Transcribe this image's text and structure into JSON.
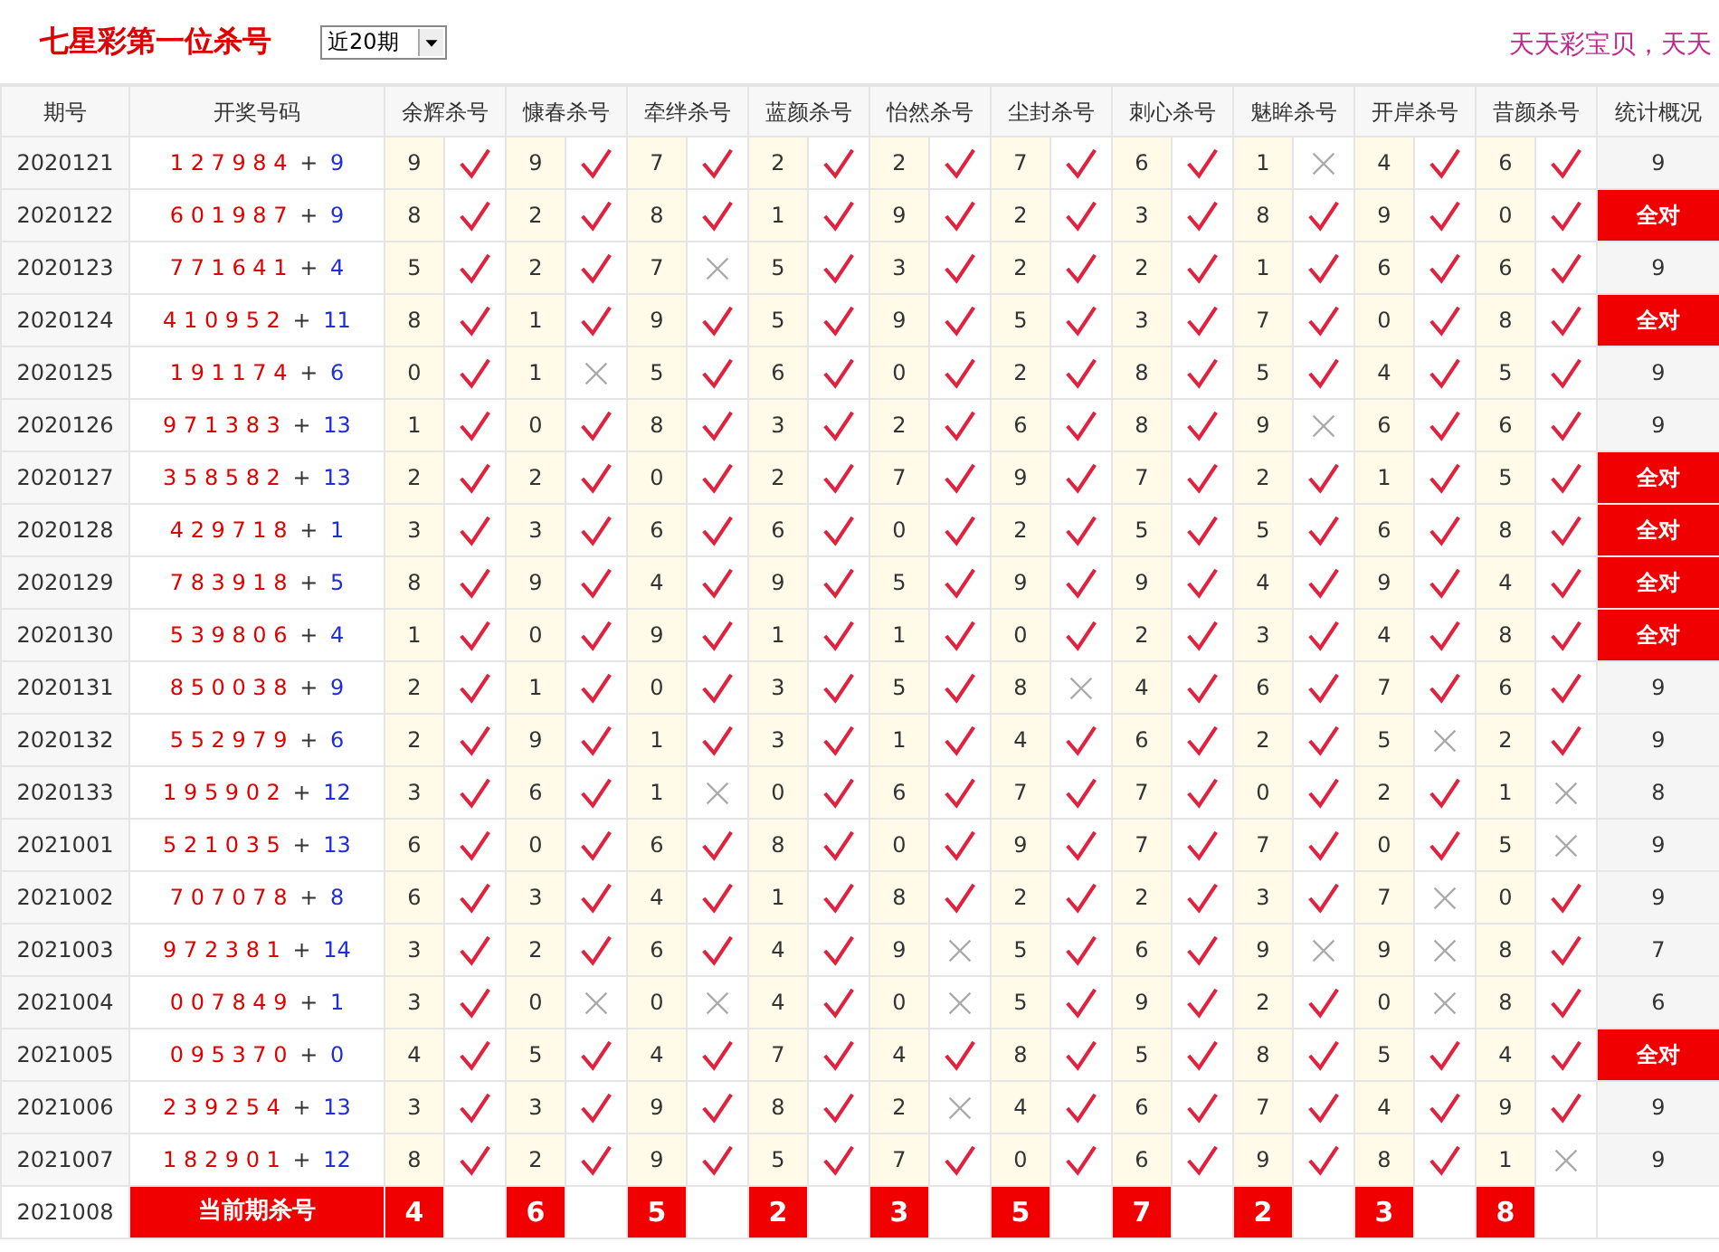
{
  "title": "七星彩第一位杀号",
  "period_select": {
    "value": "近20期"
  },
  "slogan": "天天彩宝贝，天天",
  "columns": [
    "期号",
    "开奖号码",
    "余辉杀号",
    "慷春杀号",
    "牵绊杀号",
    "蓝颜杀号",
    "怡然杀号",
    "尘封杀号",
    "刺心杀号",
    "魅眸杀号",
    "开岸杀号",
    "昔颜杀号",
    "统计概况"
  ],
  "rows": [
    {
      "period": "2020121",
      "main": "1 2 7 9 8 4",
      "plus": "+",
      "bonus": "9",
      "kills": [
        {
          "n": "9",
          "hit": true
        },
        {
          "n": "9",
          "hit": true
        },
        {
          "n": "7",
          "hit": true
        },
        {
          "n": "2",
          "hit": true
        },
        {
          "n": "2",
          "hit": true
        },
        {
          "n": "7",
          "hit": true
        },
        {
          "n": "6",
          "hit": true
        },
        {
          "n": "1",
          "hit": false
        },
        {
          "n": "4",
          "hit": true
        },
        {
          "n": "6",
          "hit": true
        }
      ],
      "stat": "9",
      "all_correct": false
    },
    {
      "period": "2020122",
      "main": "6 0 1 9 8 7",
      "plus": "+",
      "bonus": "9",
      "kills": [
        {
          "n": "8",
          "hit": true
        },
        {
          "n": "2",
          "hit": true
        },
        {
          "n": "8",
          "hit": true
        },
        {
          "n": "1",
          "hit": true
        },
        {
          "n": "9",
          "hit": true
        },
        {
          "n": "2",
          "hit": true
        },
        {
          "n": "3",
          "hit": true
        },
        {
          "n": "8",
          "hit": true
        },
        {
          "n": "9",
          "hit": true
        },
        {
          "n": "0",
          "hit": true
        }
      ],
      "stat": "全对",
      "all_correct": true
    },
    {
      "period": "2020123",
      "main": "7 7 1 6 4 1",
      "plus": "+",
      "bonus": "4",
      "kills": [
        {
          "n": "5",
          "hit": true
        },
        {
          "n": "2",
          "hit": true
        },
        {
          "n": "7",
          "hit": false
        },
        {
          "n": "5",
          "hit": true
        },
        {
          "n": "3",
          "hit": true
        },
        {
          "n": "2",
          "hit": true
        },
        {
          "n": "2",
          "hit": true
        },
        {
          "n": "1",
          "hit": true
        },
        {
          "n": "6",
          "hit": true
        },
        {
          "n": "6",
          "hit": true
        }
      ],
      "stat": "9",
      "all_correct": false
    },
    {
      "period": "2020124",
      "main": "4 1 0 9 5 2",
      "plus": "+",
      "bonus": "11",
      "kills": [
        {
          "n": "8",
          "hit": true
        },
        {
          "n": "1",
          "hit": true
        },
        {
          "n": "9",
          "hit": true
        },
        {
          "n": "5",
          "hit": true
        },
        {
          "n": "9",
          "hit": true
        },
        {
          "n": "5",
          "hit": true
        },
        {
          "n": "3",
          "hit": true
        },
        {
          "n": "7",
          "hit": true
        },
        {
          "n": "0",
          "hit": true
        },
        {
          "n": "8",
          "hit": true
        }
      ],
      "stat": "全对",
      "all_correct": true
    },
    {
      "period": "2020125",
      "main": "1 9 1 1 7 4",
      "plus": "+",
      "bonus": "6",
      "kills": [
        {
          "n": "0",
          "hit": true
        },
        {
          "n": "1",
          "hit": false
        },
        {
          "n": "5",
          "hit": true
        },
        {
          "n": "6",
          "hit": true
        },
        {
          "n": "0",
          "hit": true
        },
        {
          "n": "2",
          "hit": true
        },
        {
          "n": "8",
          "hit": true
        },
        {
          "n": "5",
          "hit": true
        },
        {
          "n": "4",
          "hit": true
        },
        {
          "n": "5",
          "hit": true
        }
      ],
      "stat": "9",
      "all_correct": false
    },
    {
      "period": "2020126",
      "main": "9 7 1 3 8 3",
      "plus": "+",
      "bonus": "13",
      "kills": [
        {
          "n": "1",
          "hit": true
        },
        {
          "n": "0",
          "hit": true
        },
        {
          "n": "8",
          "hit": true
        },
        {
          "n": "3",
          "hit": true
        },
        {
          "n": "2",
          "hit": true
        },
        {
          "n": "6",
          "hit": true
        },
        {
          "n": "8",
          "hit": true
        },
        {
          "n": "9",
          "hit": false
        },
        {
          "n": "6",
          "hit": true
        },
        {
          "n": "6",
          "hit": true
        }
      ],
      "stat": "9",
      "all_correct": false
    },
    {
      "period": "2020127",
      "main": "3 5 8 5 8 2",
      "plus": "+",
      "bonus": "13",
      "kills": [
        {
          "n": "2",
          "hit": true
        },
        {
          "n": "2",
          "hit": true
        },
        {
          "n": "0",
          "hit": true
        },
        {
          "n": "2",
          "hit": true
        },
        {
          "n": "7",
          "hit": true
        },
        {
          "n": "9",
          "hit": true
        },
        {
          "n": "7",
          "hit": true
        },
        {
          "n": "2",
          "hit": true
        },
        {
          "n": "1",
          "hit": true
        },
        {
          "n": "5",
          "hit": true
        }
      ],
      "stat": "全对",
      "all_correct": true
    },
    {
      "period": "2020128",
      "main": "4 2 9 7 1 8",
      "plus": "+",
      "bonus": "1",
      "kills": [
        {
          "n": "3",
          "hit": true
        },
        {
          "n": "3",
          "hit": true
        },
        {
          "n": "6",
          "hit": true
        },
        {
          "n": "6",
          "hit": true
        },
        {
          "n": "0",
          "hit": true
        },
        {
          "n": "2",
          "hit": true
        },
        {
          "n": "5",
          "hit": true
        },
        {
          "n": "5",
          "hit": true
        },
        {
          "n": "6",
          "hit": true
        },
        {
          "n": "8",
          "hit": true
        }
      ],
      "stat": "全对",
      "all_correct": true
    },
    {
      "period": "2020129",
      "main": "7 8 3 9 1 8",
      "plus": "+",
      "bonus": "5",
      "kills": [
        {
          "n": "8",
          "hit": true
        },
        {
          "n": "9",
          "hit": true
        },
        {
          "n": "4",
          "hit": true
        },
        {
          "n": "9",
          "hit": true
        },
        {
          "n": "5",
          "hit": true
        },
        {
          "n": "9",
          "hit": true
        },
        {
          "n": "9",
          "hit": true
        },
        {
          "n": "4",
          "hit": true
        },
        {
          "n": "9",
          "hit": true
        },
        {
          "n": "4",
          "hit": true
        }
      ],
      "stat": "全对",
      "all_correct": true
    },
    {
      "period": "2020130",
      "main": "5 3 9 8 0 6",
      "plus": "+",
      "bonus": "4",
      "kills": [
        {
          "n": "1",
          "hit": true
        },
        {
          "n": "0",
          "hit": true
        },
        {
          "n": "9",
          "hit": true
        },
        {
          "n": "1",
          "hit": true
        },
        {
          "n": "1",
          "hit": true
        },
        {
          "n": "0",
          "hit": true
        },
        {
          "n": "2",
          "hit": true
        },
        {
          "n": "3",
          "hit": true
        },
        {
          "n": "4",
          "hit": true
        },
        {
          "n": "8",
          "hit": true
        }
      ],
      "stat": "全对",
      "all_correct": true
    },
    {
      "period": "2020131",
      "main": "8 5 0 0 3 8",
      "plus": "+",
      "bonus": "9",
      "kills": [
        {
          "n": "2",
          "hit": true
        },
        {
          "n": "1",
          "hit": true
        },
        {
          "n": "0",
          "hit": true
        },
        {
          "n": "3",
          "hit": true
        },
        {
          "n": "5",
          "hit": true
        },
        {
          "n": "8",
          "hit": false
        },
        {
          "n": "4",
          "hit": true
        },
        {
          "n": "6",
          "hit": true
        },
        {
          "n": "7",
          "hit": true
        },
        {
          "n": "6",
          "hit": true
        }
      ],
      "stat": "9",
      "all_correct": false
    },
    {
      "period": "2020132",
      "main": "5 5 2 9 7 9",
      "plus": "+",
      "bonus": "6",
      "kills": [
        {
          "n": "2",
          "hit": true
        },
        {
          "n": "9",
          "hit": true
        },
        {
          "n": "1",
          "hit": true
        },
        {
          "n": "3",
          "hit": true
        },
        {
          "n": "1",
          "hit": true
        },
        {
          "n": "4",
          "hit": true
        },
        {
          "n": "6",
          "hit": true
        },
        {
          "n": "2",
          "hit": true
        },
        {
          "n": "5",
          "hit": false
        },
        {
          "n": "2",
          "hit": true
        }
      ],
      "stat": "9",
      "all_correct": false
    },
    {
      "period": "2020133",
      "main": "1 9 5 9 0 2",
      "plus": "+",
      "bonus": "12",
      "kills": [
        {
          "n": "3",
          "hit": true
        },
        {
          "n": "6",
          "hit": true
        },
        {
          "n": "1",
          "hit": false
        },
        {
          "n": "0",
          "hit": true
        },
        {
          "n": "6",
          "hit": true
        },
        {
          "n": "7",
          "hit": true
        },
        {
          "n": "7",
          "hit": true
        },
        {
          "n": "0",
          "hit": true
        },
        {
          "n": "2",
          "hit": true
        },
        {
          "n": "1",
          "hit": false
        }
      ],
      "stat": "8",
      "all_correct": false
    },
    {
      "period": "2021001",
      "main": "5 2 1 0 3 5",
      "plus": "+",
      "bonus": "13",
      "kills": [
        {
          "n": "6",
          "hit": true
        },
        {
          "n": "0",
          "hit": true
        },
        {
          "n": "6",
          "hit": true
        },
        {
          "n": "8",
          "hit": true
        },
        {
          "n": "0",
          "hit": true
        },
        {
          "n": "9",
          "hit": true
        },
        {
          "n": "7",
          "hit": true
        },
        {
          "n": "7",
          "hit": true
        },
        {
          "n": "0",
          "hit": true
        },
        {
          "n": "5",
          "hit": false
        }
      ],
      "stat": "9",
      "all_correct": false
    },
    {
      "period": "2021002",
      "main": "7 0 7 0 7 8",
      "plus": "+",
      "bonus": "8",
      "kills": [
        {
          "n": "6",
          "hit": true
        },
        {
          "n": "3",
          "hit": true
        },
        {
          "n": "4",
          "hit": true
        },
        {
          "n": "1",
          "hit": true
        },
        {
          "n": "8",
          "hit": true
        },
        {
          "n": "2",
          "hit": true
        },
        {
          "n": "2",
          "hit": true
        },
        {
          "n": "3",
          "hit": true
        },
        {
          "n": "7",
          "hit": false
        },
        {
          "n": "0",
          "hit": true
        }
      ],
      "stat": "9",
      "all_correct": false
    },
    {
      "period": "2021003",
      "main": "9 7 2 3 8 1",
      "plus": "+",
      "bonus": "14",
      "kills": [
        {
          "n": "3",
          "hit": true
        },
        {
          "n": "2",
          "hit": true
        },
        {
          "n": "6",
          "hit": true
        },
        {
          "n": "4",
          "hit": true
        },
        {
          "n": "9",
          "hit": false
        },
        {
          "n": "5",
          "hit": true
        },
        {
          "n": "6",
          "hit": true
        },
        {
          "n": "9",
          "hit": false
        },
        {
          "n": "9",
          "hit": false
        },
        {
          "n": "8",
          "hit": true
        }
      ],
      "stat": "7",
      "all_correct": false
    },
    {
      "period": "2021004",
      "main": "0 0 7 8 4 9",
      "plus": "+",
      "bonus": "1",
      "kills": [
        {
          "n": "3",
          "hit": true
        },
        {
          "n": "0",
          "hit": false
        },
        {
          "n": "0",
          "hit": false
        },
        {
          "n": "4",
          "hit": true
        },
        {
          "n": "0",
          "hit": false
        },
        {
          "n": "5",
          "hit": true
        },
        {
          "n": "9",
          "hit": true
        },
        {
          "n": "2",
          "hit": true
        },
        {
          "n": "0",
          "hit": false
        },
        {
          "n": "8",
          "hit": true
        }
      ],
      "stat": "6",
      "all_correct": false
    },
    {
      "period": "2021005",
      "main": "0 9 5 3 7 0",
      "plus": "+",
      "bonus": "0",
      "kills": [
        {
          "n": "4",
          "hit": true
        },
        {
          "n": "5",
          "hit": true
        },
        {
          "n": "4",
          "hit": true
        },
        {
          "n": "7",
          "hit": true
        },
        {
          "n": "4",
          "hit": true
        },
        {
          "n": "8",
          "hit": true
        },
        {
          "n": "5",
          "hit": true
        },
        {
          "n": "8",
          "hit": true
        },
        {
          "n": "5",
          "hit": true
        },
        {
          "n": "4",
          "hit": true
        }
      ],
      "stat": "全对",
      "all_correct": true
    },
    {
      "period": "2021006",
      "main": "2 3 9 2 5 4",
      "plus": "+",
      "bonus": "13",
      "kills": [
        {
          "n": "3",
          "hit": true
        },
        {
          "n": "3",
          "hit": true
        },
        {
          "n": "9",
          "hit": true
        },
        {
          "n": "8",
          "hit": true
        },
        {
          "n": "2",
          "hit": false
        },
        {
          "n": "4",
          "hit": true
        },
        {
          "n": "6",
          "hit": true
        },
        {
          "n": "7",
          "hit": true
        },
        {
          "n": "4",
          "hit": true
        },
        {
          "n": "9",
          "hit": true
        }
      ],
      "stat": "9",
      "all_correct": false
    },
    {
      "period": "2021007",
      "main": "1 8 2 9 0 1",
      "plus": "+",
      "bonus": "12",
      "kills": [
        {
          "n": "8",
          "hit": true
        },
        {
          "n": "2",
          "hit": true
        },
        {
          "n": "9",
          "hit": true
        },
        {
          "n": "5",
          "hit": true
        },
        {
          "n": "7",
          "hit": true
        },
        {
          "n": "0",
          "hit": true
        },
        {
          "n": "6",
          "hit": true
        },
        {
          "n": "9",
          "hit": true
        },
        {
          "n": "8",
          "hit": true
        },
        {
          "n": "1",
          "hit": false
        }
      ],
      "stat": "9",
      "all_correct": false
    }
  ],
  "current": {
    "period": "2021008",
    "label": "当前期杀号",
    "kills": [
      "4",
      "6",
      "5",
      "2",
      "3",
      "5",
      "7",
      "2",
      "3",
      "8"
    ]
  }
}
